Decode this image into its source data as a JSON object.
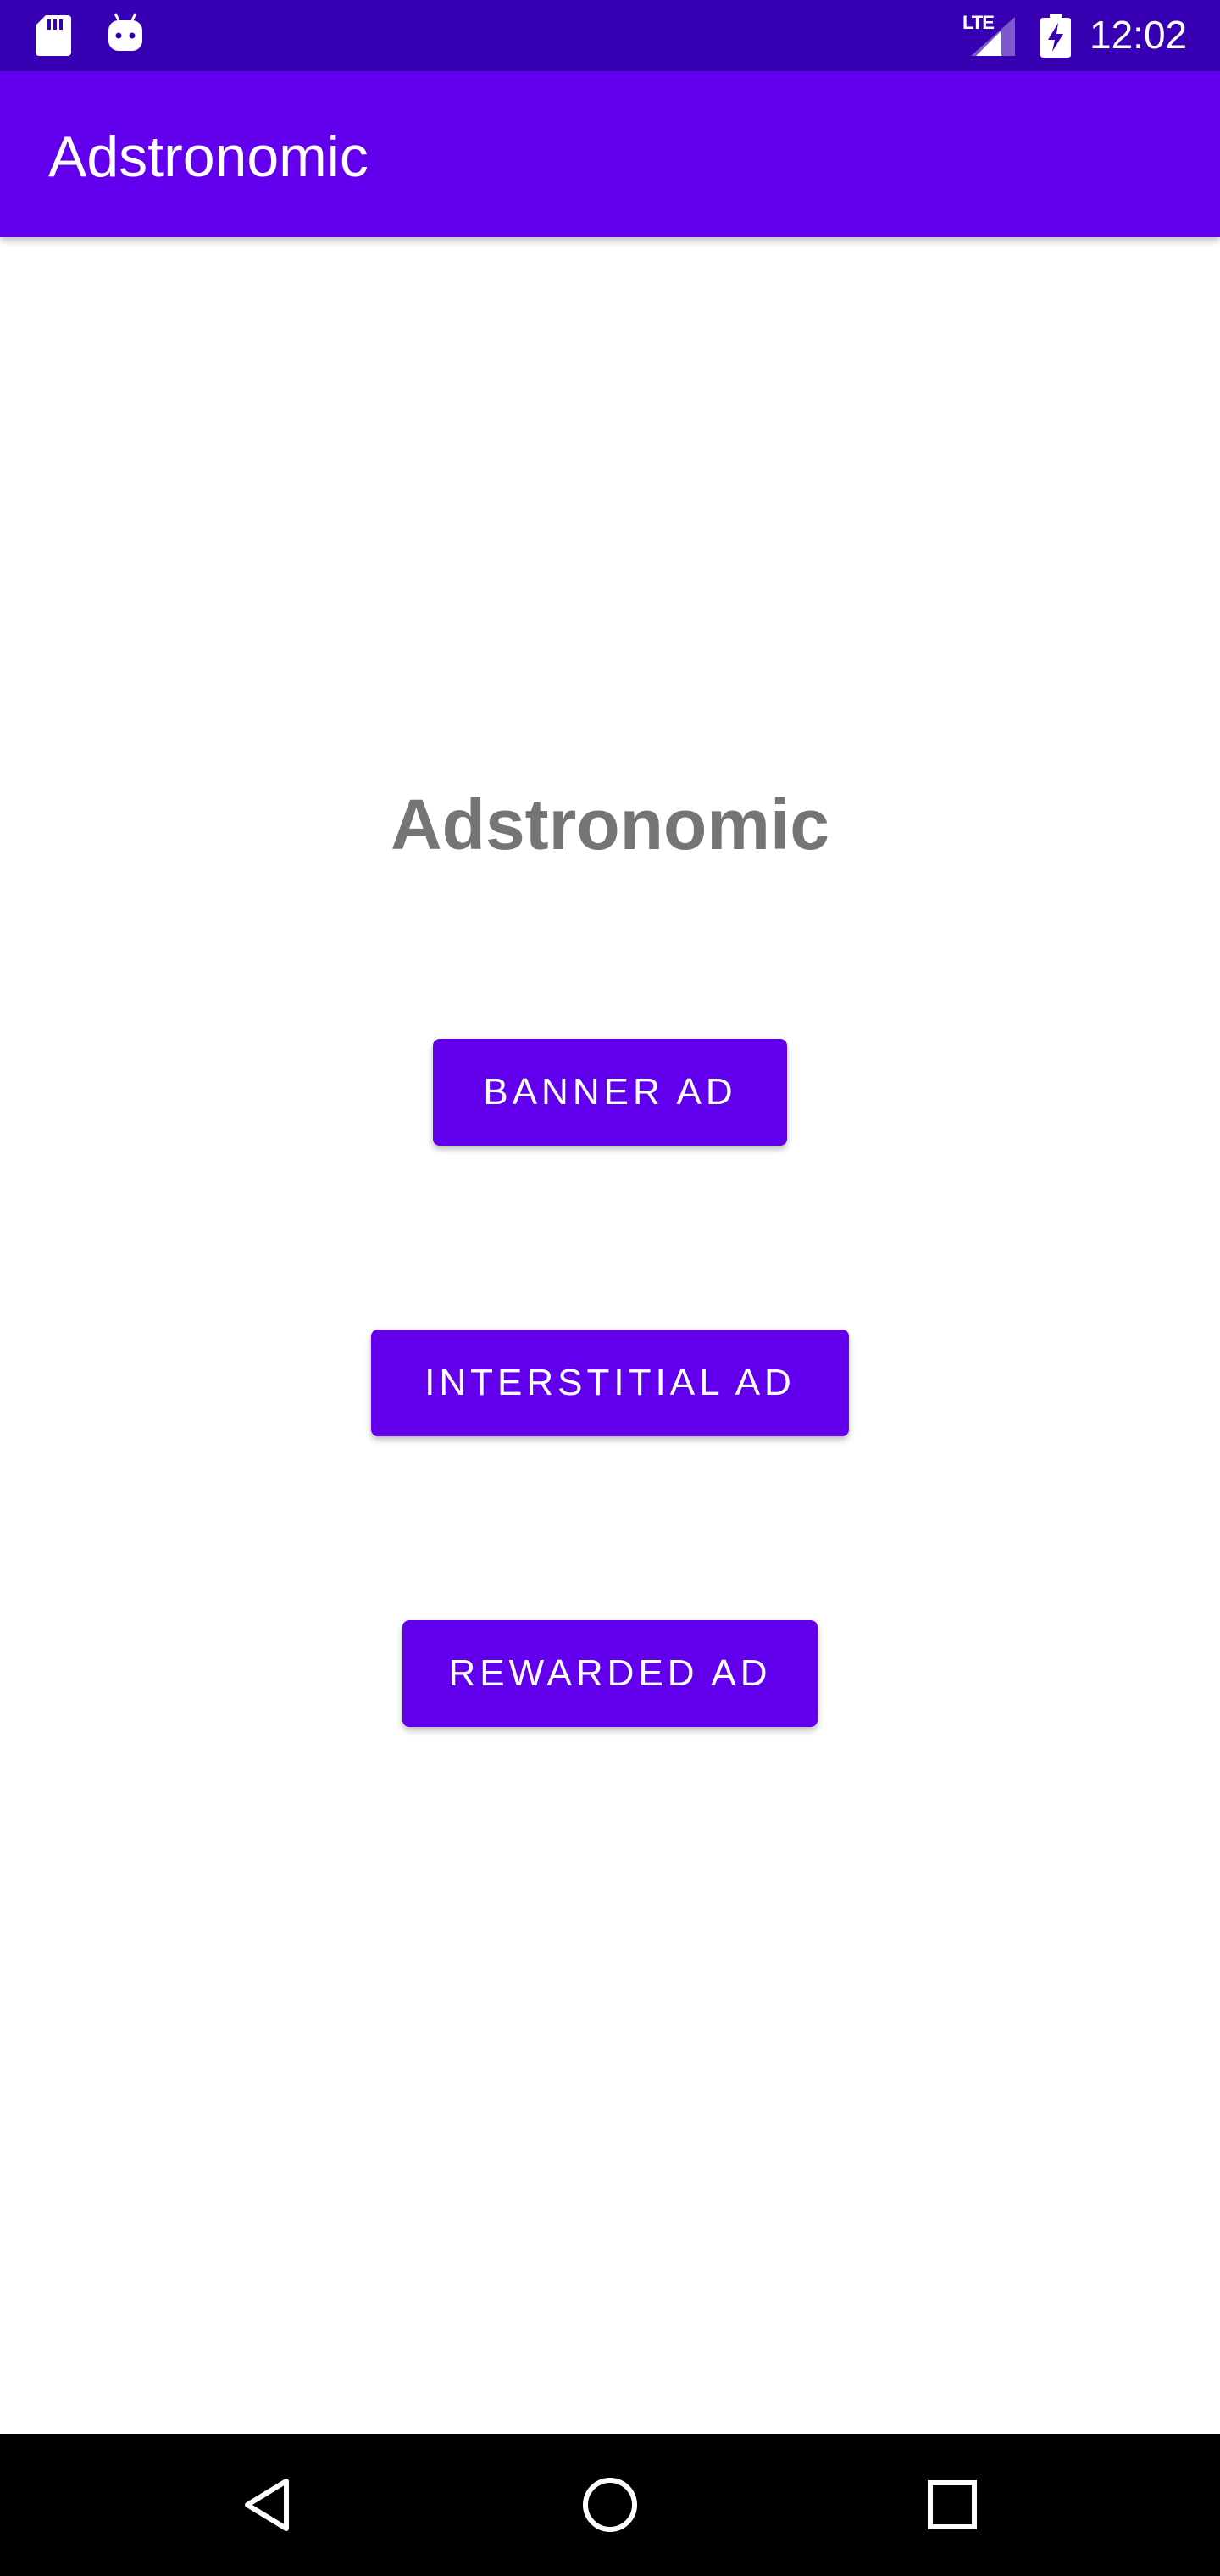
{
  "status_bar": {
    "network_label": "LTE",
    "time": "12:02",
    "icons": [
      "sd-card-icon",
      "android-icon",
      "signal-icon",
      "battery-charging-icon"
    ]
  },
  "app_bar": {
    "title": "Adstronomic"
  },
  "main": {
    "title": "Adstronomic",
    "buttons": {
      "banner": "BANNER AD",
      "interstitial": "INTERSTITIAL AD",
      "rewarded": "REWARDED AD"
    }
  },
  "nav_bar": {
    "icons": [
      "back-icon",
      "home-icon",
      "recents-icon"
    ]
  },
  "colors": {
    "status_bar": "#3700b3",
    "primary": "#6200ee",
    "title_text": "#757575",
    "nav_bar": "#000000"
  }
}
